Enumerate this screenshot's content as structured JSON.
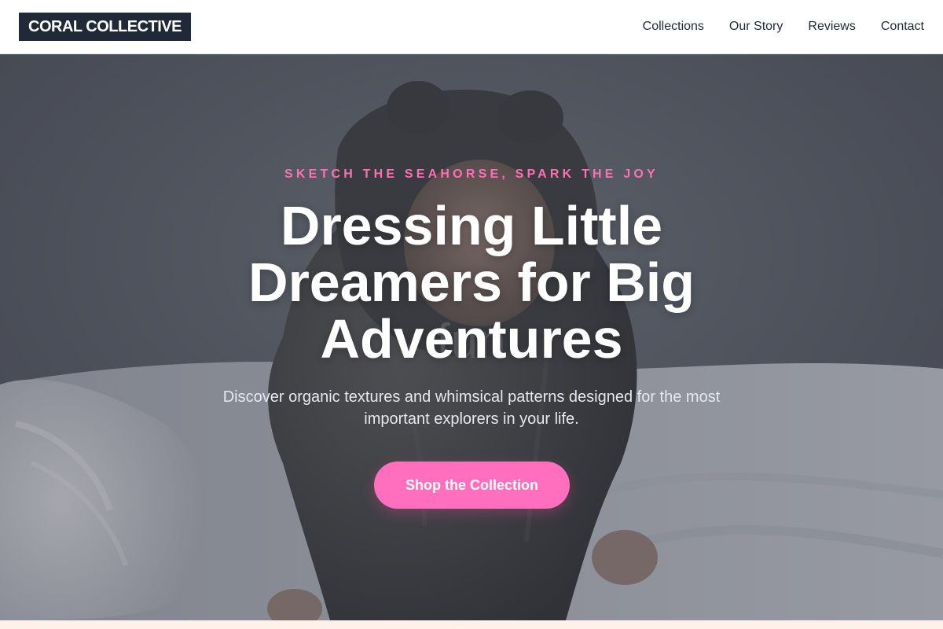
{
  "header": {
    "logo_text": "CORAL COLLECTIVE",
    "nav": [
      {
        "label": "Collections"
      },
      {
        "label": "Our Story"
      },
      {
        "label": "Reviews"
      },
      {
        "label": "Contact"
      }
    ]
  },
  "hero": {
    "eyebrow": "SKETCH THE SEAHORSE, SPARK THE JOY",
    "title": "Dressing Little Dreamers for Big Adventures",
    "subtitle": "Discover organic textures and whimsical patterns designed for the most important explorers in your life.",
    "cta_label": "Shop the Collection"
  },
  "colors": {
    "accent": "#ff6fbd",
    "logo_bg": "#1f2937",
    "text_dark": "#1f2937"
  }
}
